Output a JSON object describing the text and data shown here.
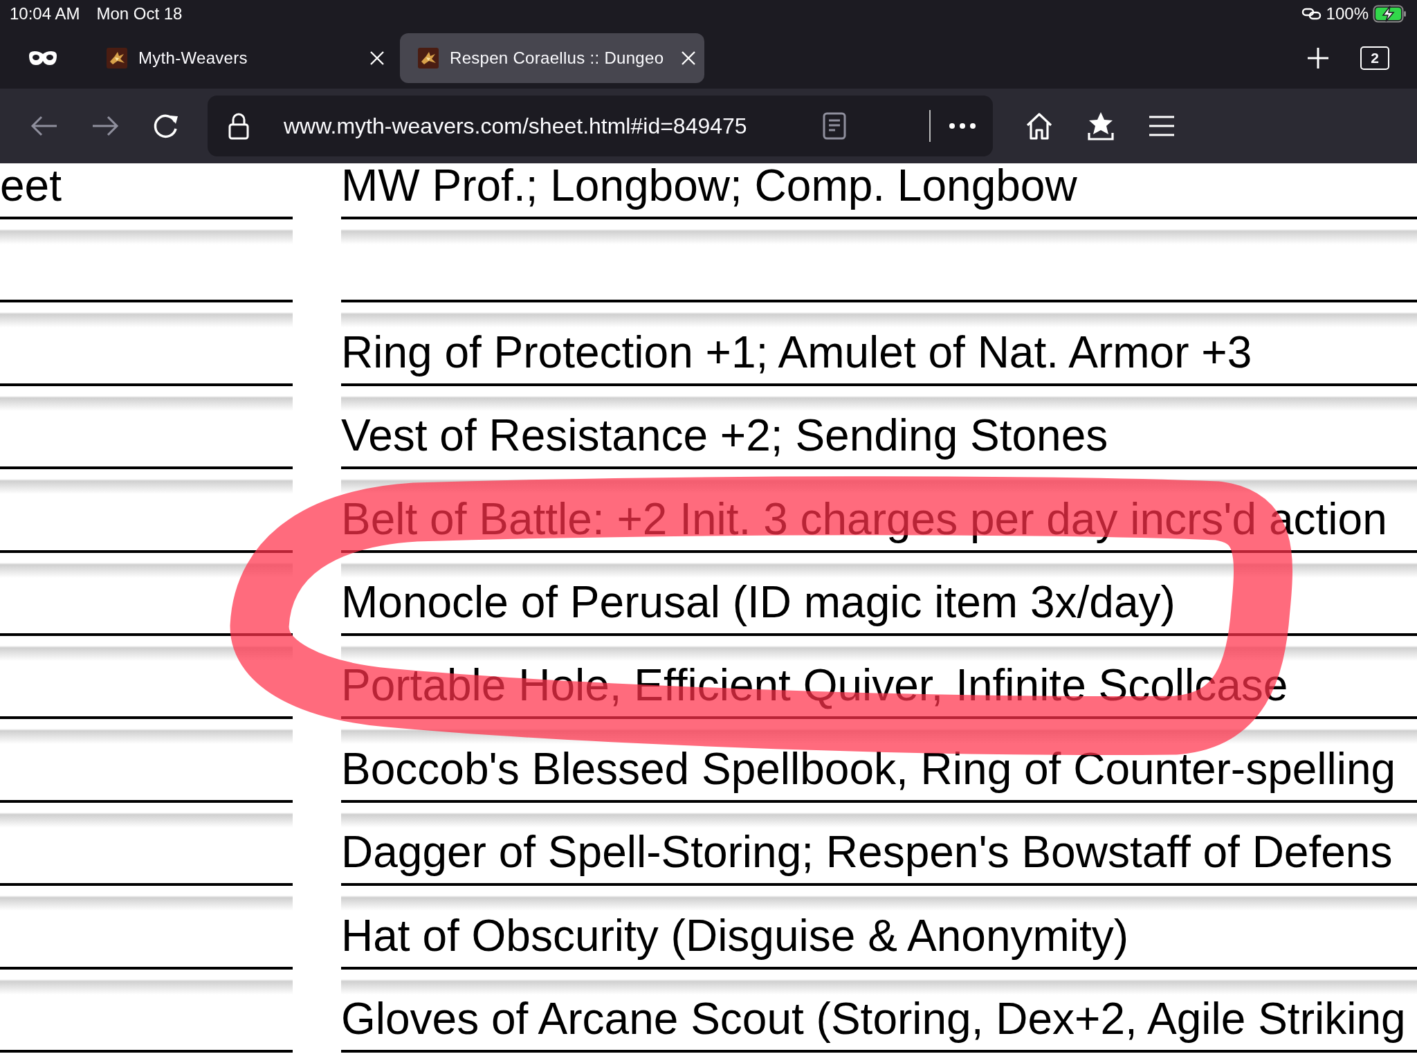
{
  "status_bar": {
    "time": "10:04 AM",
    "date": "Mon Oct 18",
    "battery": "100%"
  },
  "tabs": [
    {
      "title": "Myth-Weavers",
      "selected": false
    },
    {
      "title": "Respen Coraellus :: Dungeo",
      "selected": true
    }
  ],
  "tab_count": "2",
  "address_bar": {
    "url": "www.myth-weavers.com/sheet.html#id=849475"
  },
  "sheet_rows": [
    {
      "left": "eet",
      "right": "MW Prof.; Longbow; Comp. Longbow"
    },
    {},
    {
      "right": "Ring of Protection +1; Amulet of Nat. Armor +3"
    },
    {
      "right": "Vest of Resistance +2; Sending Stones"
    },
    {
      "right": "Belt of Battle: +2 Init. 3 charges per day incrs'd action"
    },
    {
      "right": "Monocle of Perusal (ID magic item 3x/day)"
    },
    {
      "right": "Portable Hole, Efficient Quiver, Infinite Scollcase"
    },
    {
      "right": "Boccob's Blessed Spellbook, Ring of Counter-spelling"
    },
    {
      "right": "Dagger of Spell-Storing; Respen's Bowstaff of Defens"
    },
    {
      "right": "Hat of Obscurity (Disguise & Anonymity)"
    },
    {
      "right": "Gloves of Arcane Scout (Storing, Dex+2, Agile Striking"
    }
  ]
}
